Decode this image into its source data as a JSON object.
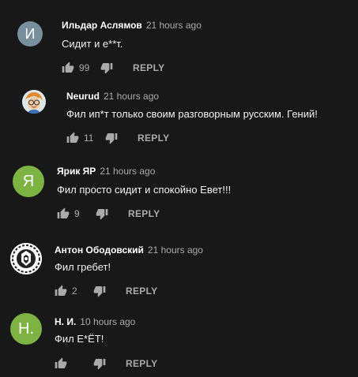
{
  "reply_label": "REPLY",
  "comments": [
    {
      "author": "Ильдар Аслямов",
      "time": "21 hours ago",
      "text": "Сидит и е**т.",
      "likes": "99",
      "avatar_letter": "И",
      "avatar_color": "#78909c"
    },
    {
      "author": "Neurud",
      "time": "21 hours ago",
      "text": "Фил ип*т только своим разговорным русским. Гений!",
      "likes": "11",
      "avatar_icon": "cartoon-character-icon"
    },
    {
      "author": "Ярик ЯР",
      "time": "21 hours ago",
      "text": "Фил просто сидит и спокойно Евет!!!",
      "likes": "9",
      "avatar_letter": "Я",
      "avatar_color": "#7cb342"
    },
    {
      "author": "Антон Ободовский",
      "time": "21 hours ago",
      "text": "Фил гребет!",
      "likes": "2",
      "avatar_icon": "emblem-crest-icon"
    },
    {
      "author": "Н. И.",
      "time": "10 hours ago",
      "text": "Фил Е*ЁТ!",
      "likes": "",
      "avatar_letter": "Н.",
      "avatar_color": "#7cb342"
    }
  ]
}
